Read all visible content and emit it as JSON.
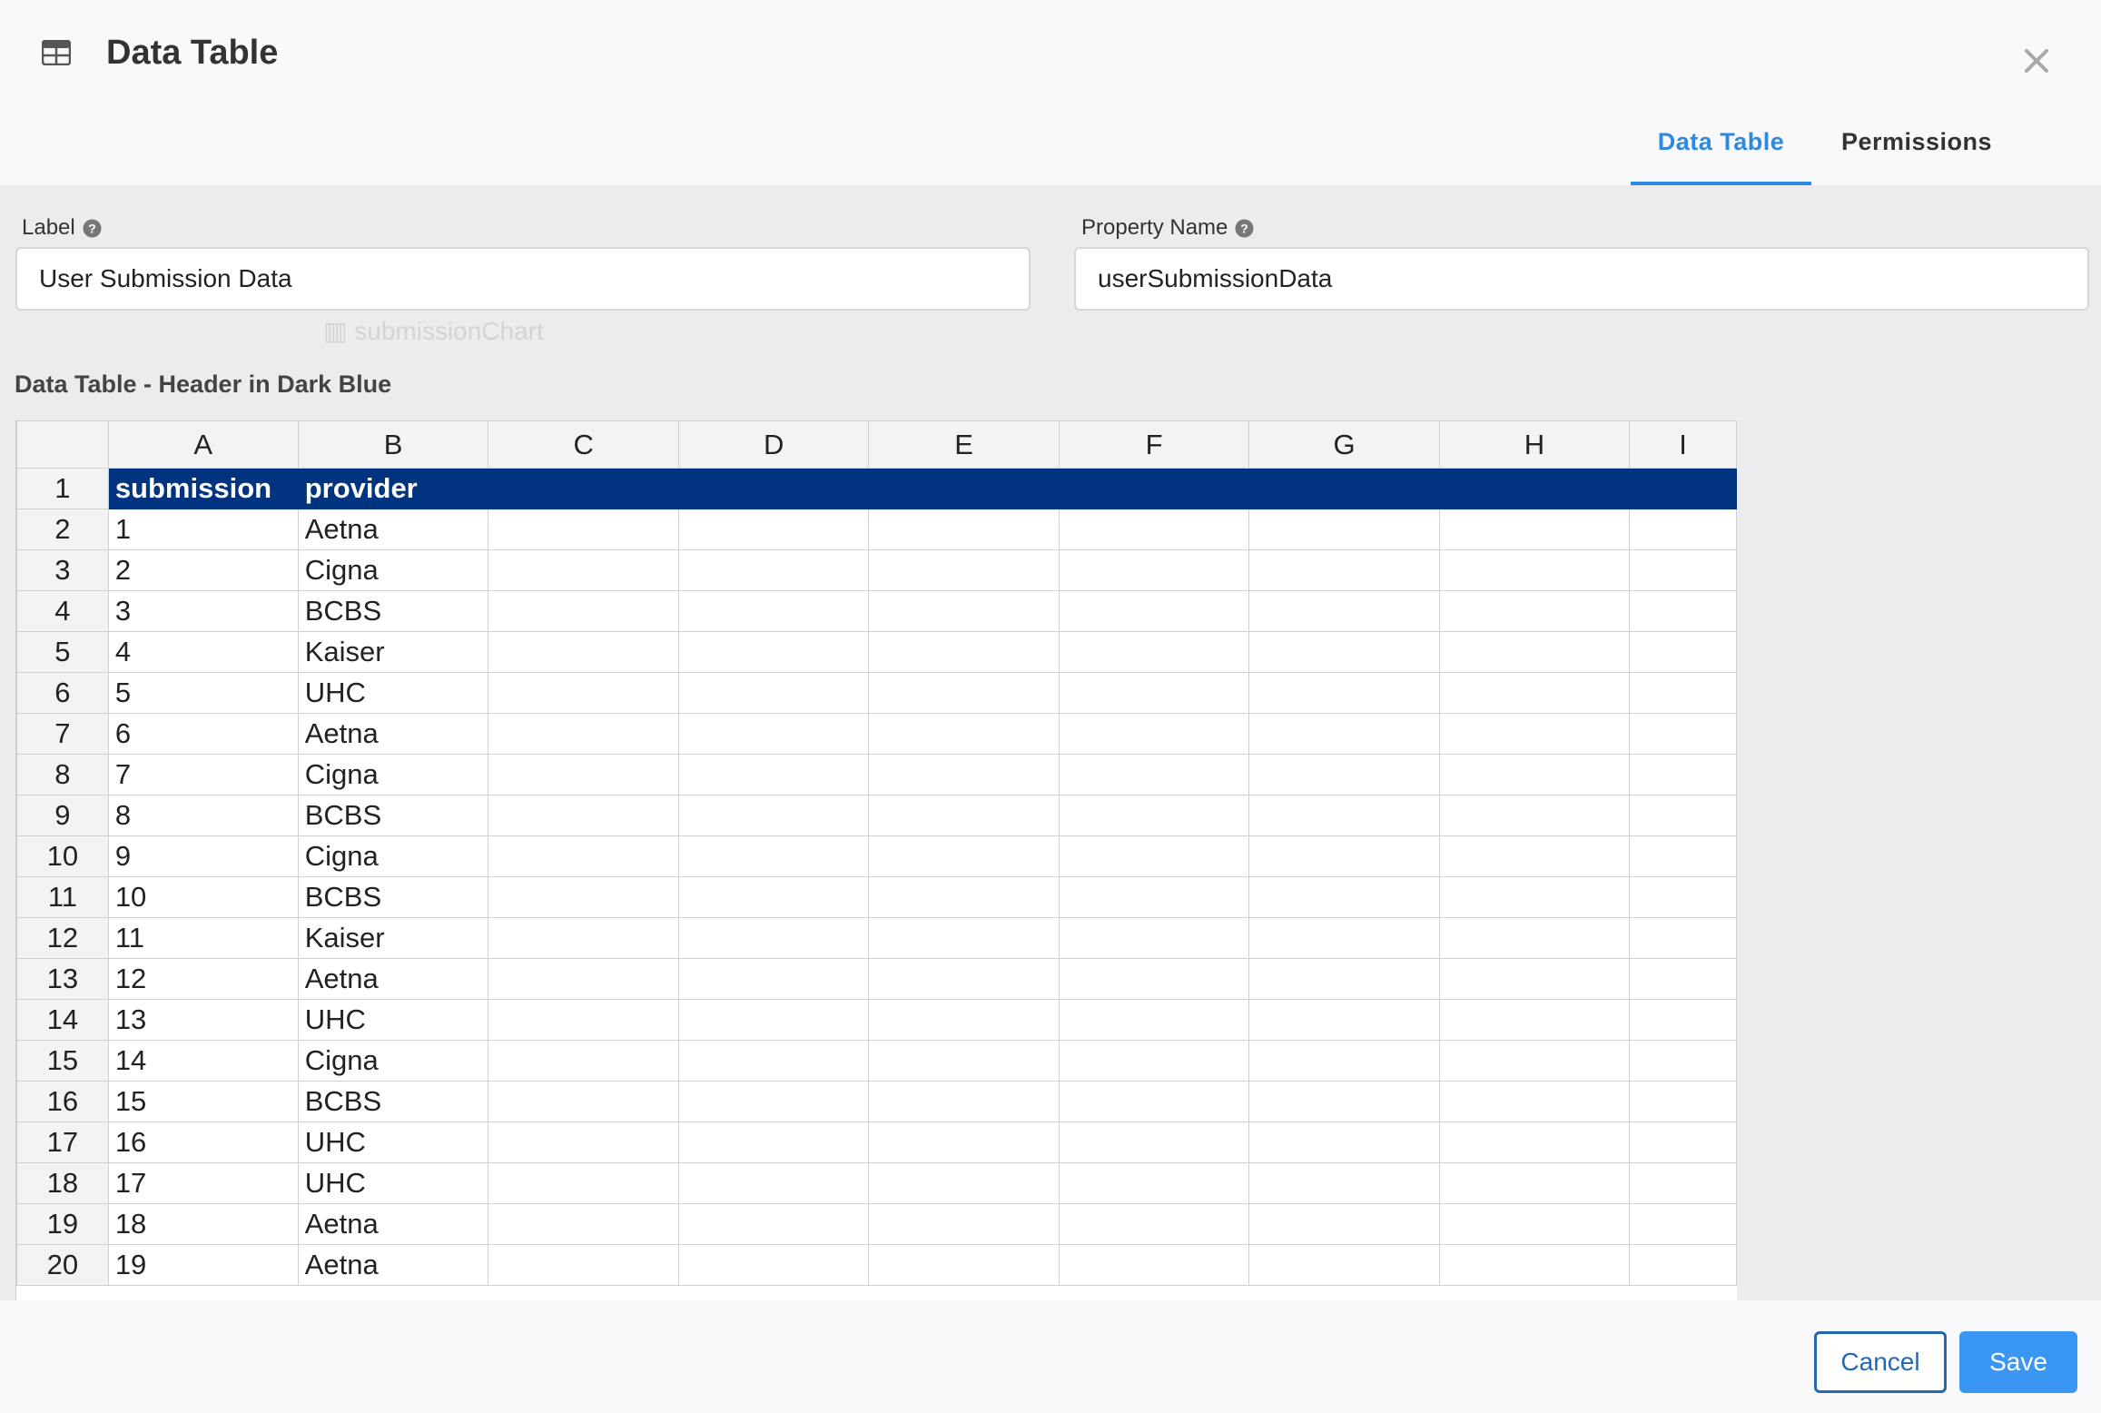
{
  "modal": {
    "title": "Data Table",
    "icon": "table-icon",
    "close_icon": "close-icon"
  },
  "tabs": [
    {
      "label": "Data Table",
      "active": true
    },
    {
      "label": "Permissions",
      "active": false
    }
  ],
  "background_ghost_text": "submissionChart",
  "fields": {
    "label": {
      "label": "Label",
      "value": "User Submission Data"
    },
    "property_name": {
      "label": "Property Name",
      "value": "userSubmissionData"
    }
  },
  "section_title": "Data Table - Header in Dark Blue",
  "sheet": {
    "columns": [
      "A",
      "B",
      "C",
      "D",
      "E",
      "F",
      "G",
      "H",
      "I"
    ],
    "row_numbers": [
      "1",
      "2",
      "3",
      "4",
      "5",
      "6",
      "7",
      "8",
      "9",
      "10",
      "11",
      "12",
      "13",
      "14",
      "15",
      "16",
      "17",
      "18",
      "19",
      "20"
    ],
    "rows": [
      [
        "submission",
        "provider"
      ],
      [
        "1",
        "Aetna"
      ],
      [
        "2",
        "Cigna"
      ],
      [
        "3",
        "BCBS"
      ],
      [
        "4",
        "Kaiser"
      ],
      [
        "5",
        "UHC"
      ],
      [
        "6",
        "Aetna"
      ],
      [
        "7",
        "Cigna"
      ],
      [
        "8",
        "BCBS"
      ],
      [
        "9",
        "Cigna"
      ],
      [
        "10",
        "BCBS"
      ],
      [
        "11",
        "Kaiser"
      ],
      [
        "12",
        "Aetna"
      ],
      [
        "13",
        "UHC"
      ],
      [
        "14",
        "Cigna"
      ],
      [
        "15",
        "BCBS"
      ],
      [
        "16",
        "UHC"
      ],
      [
        "17",
        "UHC"
      ],
      [
        "18",
        "Aetna"
      ],
      [
        "19",
        "Aetna"
      ]
    ],
    "header_color": "#003380"
  },
  "buttons": {
    "cancel": "Cancel",
    "save": "Save"
  },
  "colors": {
    "accent": "#2d8ae0",
    "save_button": "#3a96f3",
    "cancel_border": "#2567b0"
  }
}
